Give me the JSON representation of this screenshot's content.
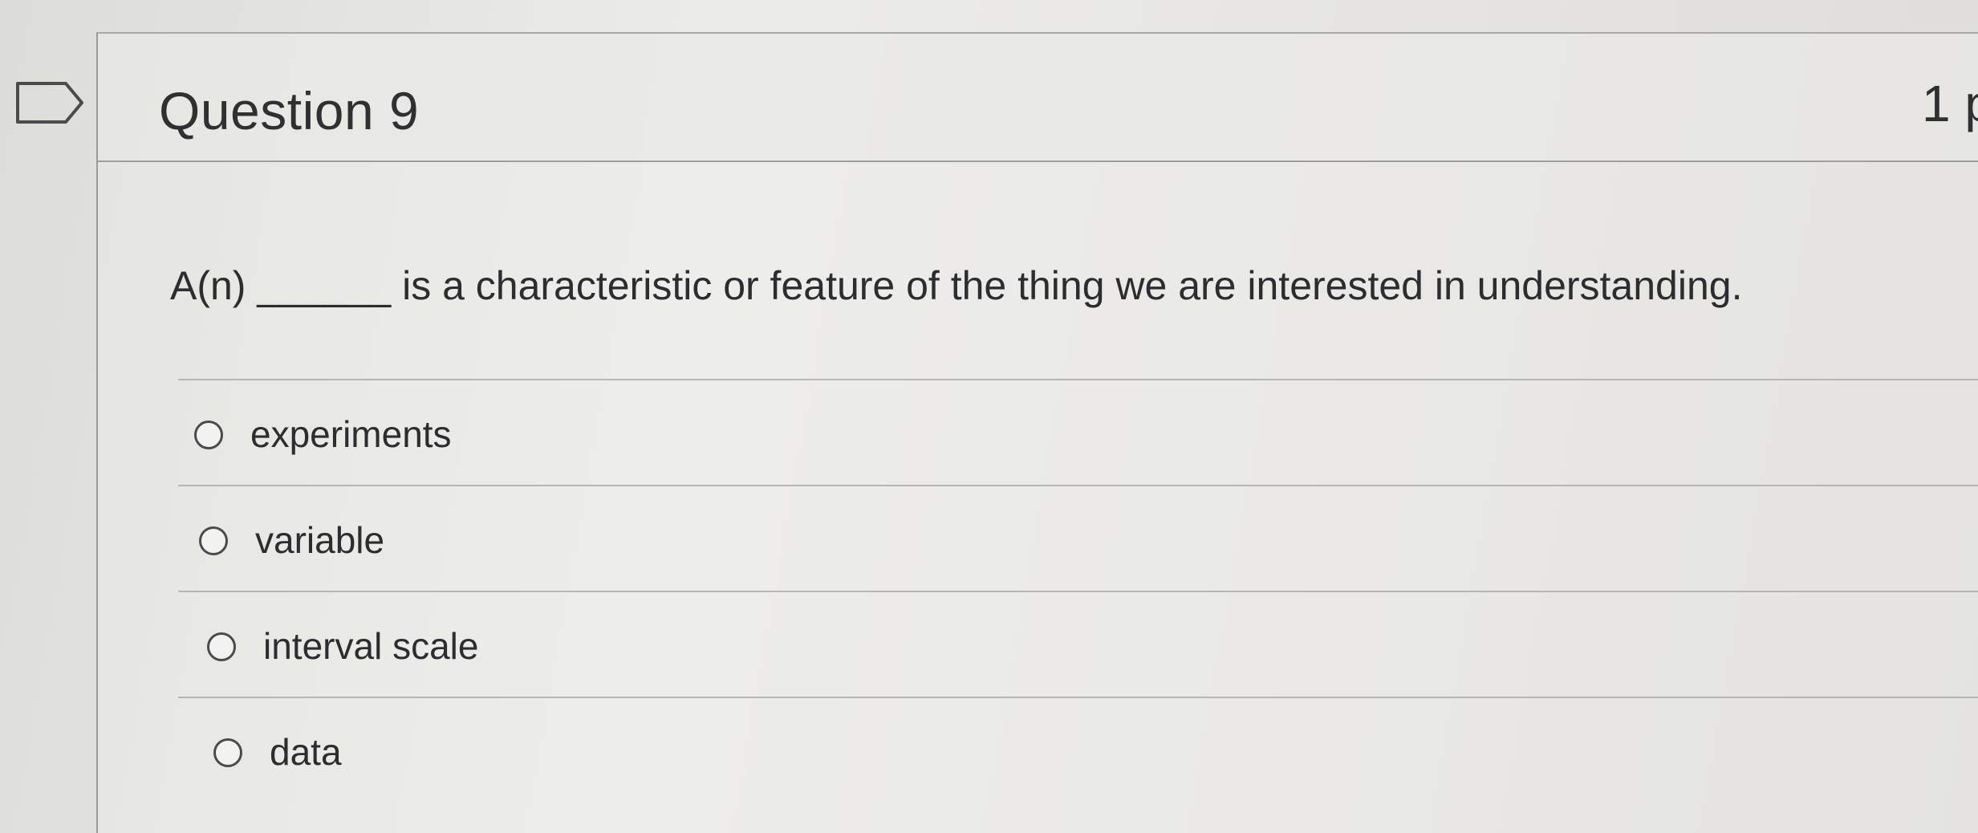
{
  "question": {
    "title": "Question 9",
    "points": "1 p",
    "text": "A(n) ______ is a characteristic or feature of the thing we are interested in understanding.",
    "answers": [
      {
        "label": "experiments"
      },
      {
        "label": "variable"
      },
      {
        "label": "interval scale"
      },
      {
        "label": "data"
      }
    ]
  },
  "colors": {
    "text": "#2c2d30",
    "border": "#9f9f9d",
    "background": "#e6e6e3"
  }
}
